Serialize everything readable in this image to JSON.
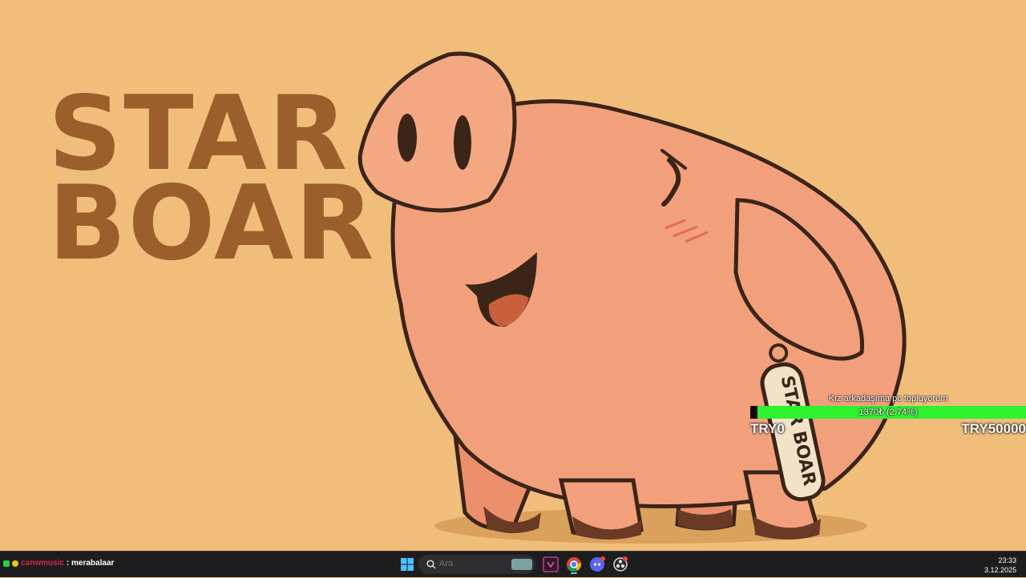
{
  "wallpaper": {
    "brand_line1": "STAR",
    "brand_line2": "BOAR",
    "tag_text": "STAR BOAR",
    "colors": {
      "background": "#f0bd7b",
      "pig": "#f2a07c",
      "outline": "#3b2418",
      "brand": "#9a5f2a"
    }
  },
  "goal": {
    "title": "Kız arkadaşıma pc topluyorum",
    "progress_text": "1370₺ (2.74%)",
    "progress_fraction": 0.0274,
    "min_label": "TRY0",
    "max_label": "TRY50000",
    "colors": {
      "bar": "#2ef32e",
      "fill": "#0a0a0a"
    }
  },
  "chat": {
    "username": "canwmusic",
    "message": ": merabalaar"
  },
  "taskbar": {
    "search_placeholder": "Ara",
    "icons": [
      "windows-start-icon",
      "search-icon",
      "vscode-icon",
      "chrome-icon",
      "discord-icon",
      "obs-icon"
    ],
    "clock_time": "23:33",
    "clock_date": "3.12.2025"
  }
}
